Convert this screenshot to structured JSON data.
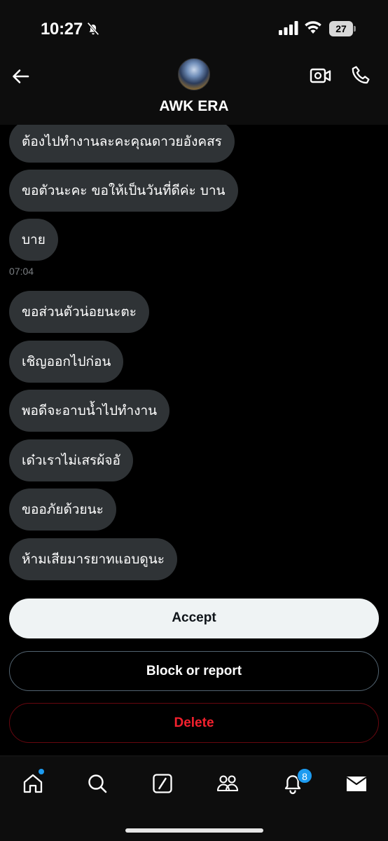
{
  "status_bar": {
    "time": "10:27",
    "battery_level": "27",
    "icons": [
      "bell-off-icon",
      "cellular-signal-icon",
      "wifi-icon",
      "battery-icon"
    ]
  },
  "header": {
    "chat_name": "AWK ERA",
    "icons": [
      "back-arrow-icon",
      "video-call-icon",
      "phone-call-icon"
    ]
  },
  "messages": [
    {
      "text": "ต้องไปทำงานละคะคุณดาวยอังคสร"
    },
    {
      "text": "ขอตัวนะคะ ขอให้เป็นวันที่ดีค่ะ บาน"
    },
    {
      "text": "บาย"
    },
    {
      "text": "ขอส่วนตัวน่อยนะตะ"
    },
    {
      "text": "เชิญออกไปก่อน"
    },
    {
      "text": "พอดีจะอาบน้ำไปทำงาน"
    },
    {
      "text": "เด๋วเราไม่เสรผ้จอั"
    },
    {
      "text": "ขออภัยด้วยนะ"
    },
    {
      "text": "ห้ามเสียมารยาทแอบดูนะ"
    }
  ],
  "timestamp": "07:04",
  "actions": {
    "accept": "Accept",
    "block_report": "Block or report",
    "delete": "Delete"
  },
  "tab_bar": {
    "icons": [
      "home-icon",
      "search-icon",
      "grok-icon",
      "communities-icon",
      "notifications-icon",
      "messages-icon"
    ],
    "notification_count": "8"
  },
  "colors": {
    "bubble": "#2f3336",
    "accent": "#1d9bf0",
    "danger": "#f4212e",
    "accept_bg": "#eff3f4"
  }
}
